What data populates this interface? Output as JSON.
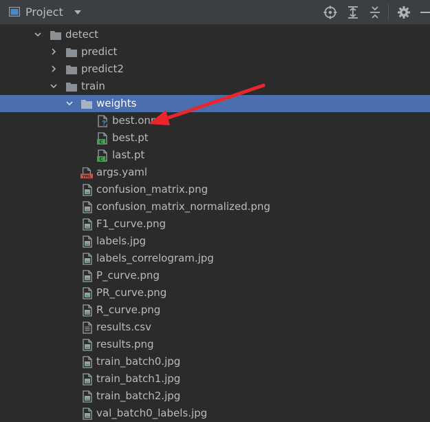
{
  "header": {
    "title": "Project",
    "icons": [
      "project-view-icon",
      "dropdown-icon",
      "locate-icon",
      "expand-all-icon",
      "collapse-all-icon",
      "settings-icon",
      "hide-icon"
    ]
  },
  "tree": {
    "items": [
      {
        "label": "detect",
        "kind": "folder",
        "expanded": true
      },
      {
        "label": "predict",
        "kind": "folder",
        "expanded": false
      },
      {
        "label": "predict2",
        "kind": "folder",
        "expanded": false
      },
      {
        "label": "train",
        "kind": "folder",
        "expanded": true
      },
      {
        "label": "weights",
        "kind": "folder",
        "expanded": true,
        "selected": true
      },
      {
        "label": "best.onnx",
        "kind": "unknown-file"
      },
      {
        "label": "best.pt",
        "kind": "code-file"
      },
      {
        "label": "last.pt",
        "kind": "code-file"
      },
      {
        "label": "args.yaml",
        "kind": "yaml-file"
      },
      {
        "label": "confusion_matrix.png",
        "kind": "image-file"
      },
      {
        "label": "confusion_matrix_normalized.png",
        "kind": "image-file"
      },
      {
        "label": "F1_curve.png",
        "kind": "image-file"
      },
      {
        "label": "labels.jpg",
        "kind": "image-file"
      },
      {
        "label": "labels_correlogram.jpg",
        "kind": "image-file"
      },
      {
        "label": "P_curve.png",
        "kind": "image-file"
      },
      {
        "label": "PR_curve.png",
        "kind": "image-file"
      },
      {
        "label": "R_curve.png",
        "kind": "image-file"
      },
      {
        "label": "results.csv",
        "kind": "text-file"
      },
      {
        "label": "results.png",
        "kind": "image-file"
      },
      {
        "label": "train_batch0.jpg",
        "kind": "image-file"
      },
      {
        "label": "train_batch1.jpg",
        "kind": "image-file"
      },
      {
        "label": "train_batch2.jpg",
        "kind": "image-file"
      },
      {
        "label": "val_batch0_labels.jpg",
        "kind": "image-file"
      }
    ]
  },
  "badges": {
    "yaml": "YML",
    "code": "C"
  },
  "colors": {
    "background": "#2b2b2b",
    "toolbar": "#3c3f41",
    "selection": "#4b6eaf",
    "folder": "#8a8f93",
    "annotation_arrow": "#e8262c"
  }
}
